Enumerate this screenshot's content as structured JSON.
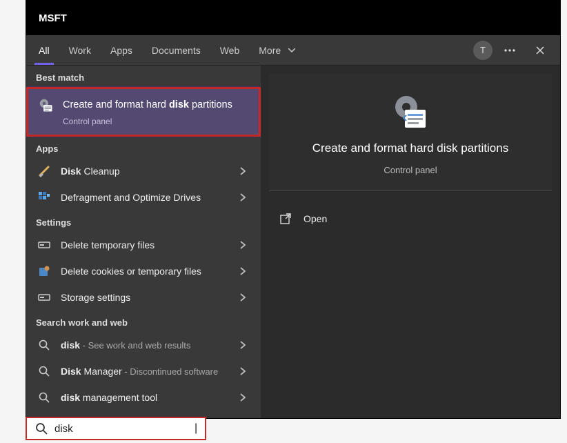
{
  "titlebar": {
    "title": "MSFT"
  },
  "tabs": {
    "items": [
      {
        "label": "All",
        "active": true
      },
      {
        "label": "Work",
        "active": false
      },
      {
        "label": "Apps",
        "active": false
      },
      {
        "label": "Documents",
        "active": false
      },
      {
        "label": "Web",
        "active": false
      },
      {
        "label": "More",
        "active": false,
        "caret": true
      }
    ],
    "avatar_initial": "T"
  },
  "sections": {
    "best_match_label": "Best match",
    "apps_label": "Apps",
    "settings_label": "Settings",
    "search_web_label": "Search work and web"
  },
  "best_match": {
    "title_pre": "Create and format hard ",
    "title_bold": "disk",
    "title_post": " partitions",
    "subtitle": "Control panel"
  },
  "apps": [
    {
      "icon": "broom",
      "label_bold": "Disk",
      "label_rest": " Cleanup"
    },
    {
      "icon": "defrag",
      "label_bold": "",
      "label_rest": "Defragment and Optimize Drives"
    }
  ],
  "settings": [
    {
      "icon": "trash",
      "label": "Delete temporary files"
    },
    {
      "icon": "cookies",
      "label": "Delete cookies or temporary files"
    },
    {
      "icon": "storage",
      "label": "Storage settings"
    }
  ],
  "search_web": [
    {
      "term_bold": "disk",
      "term_rest": "",
      "suffix": " - See work and web results"
    },
    {
      "term_bold": "Disk",
      "term_rest": " Manager",
      "suffix": " - Discontinued software"
    },
    {
      "term_bold": "disk ",
      "term_rest": "management tool",
      "suffix": ""
    }
  ],
  "preview": {
    "title": "Create and format hard disk partitions",
    "subtitle": "Control panel",
    "open_label": "Open"
  },
  "search": {
    "value": "disk",
    "cursor": "|"
  }
}
